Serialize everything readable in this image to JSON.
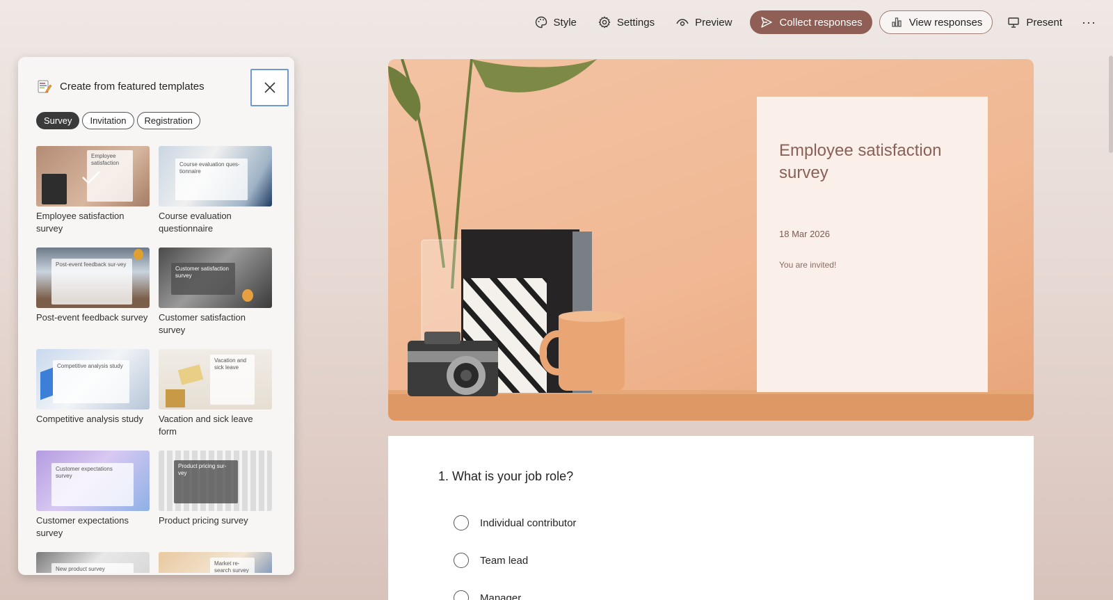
{
  "toolbar": {
    "style_label": "Style",
    "settings_label": "Settings",
    "preview_label": "Preview",
    "collect_label": "Collect responses",
    "view_label": "View responses",
    "present_label": "Present",
    "more_label": "···"
  },
  "panel": {
    "title": "Create from featured templates",
    "chips": [
      "Survey",
      "Invitation",
      "Registration"
    ],
    "active_chip": "Survey",
    "templates": [
      {
        "title": "Employee satisfaction survey",
        "thumb_text": "Employee satisfaction",
        "selected": true
      },
      {
        "title": "Course evaluation questionnaire",
        "thumb_text": "Course evaluation ques-tionnaire"
      },
      {
        "title": "Post-event feedback survey",
        "thumb_text": "Post-event feedback sur-vey"
      },
      {
        "title": "Customer satisfaction survey",
        "thumb_text": "Customer satisfaction survey"
      },
      {
        "title": "Competitive analysis study",
        "thumb_text": "Competitive analysis study"
      },
      {
        "title": "Vacation and sick leave form",
        "thumb_text": "Vacation and sick leave"
      },
      {
        "title": "Customer expectations survey",
        "thumb_text": "Customer expectations survey"
      },
      {
        "title": "Product pricing survey",
        "thumb_text": "Product pricing sur-vey"
      },
      {
        "title": "",
        "thumb_text": "New product survey"
      },
      {
        "title": "",
        "thumb_text": "Market re-search survey"
      }
    ]
  },
  "form": {
    "title": "Employee satisfaction survey",
    "date": "18 Mar 2026",
    "invite": "You are invited!",
    "question": "1. What is your job role?",
    "options": [
      "Individual contributor",
      "Team lead",
      "Manager"
    ]
  },
  "colors": {
    "accent": "#8f5f55",
    "hero_bg": "#f0b894",
    "panel_bg": "#f8f6f5"
  }
}
